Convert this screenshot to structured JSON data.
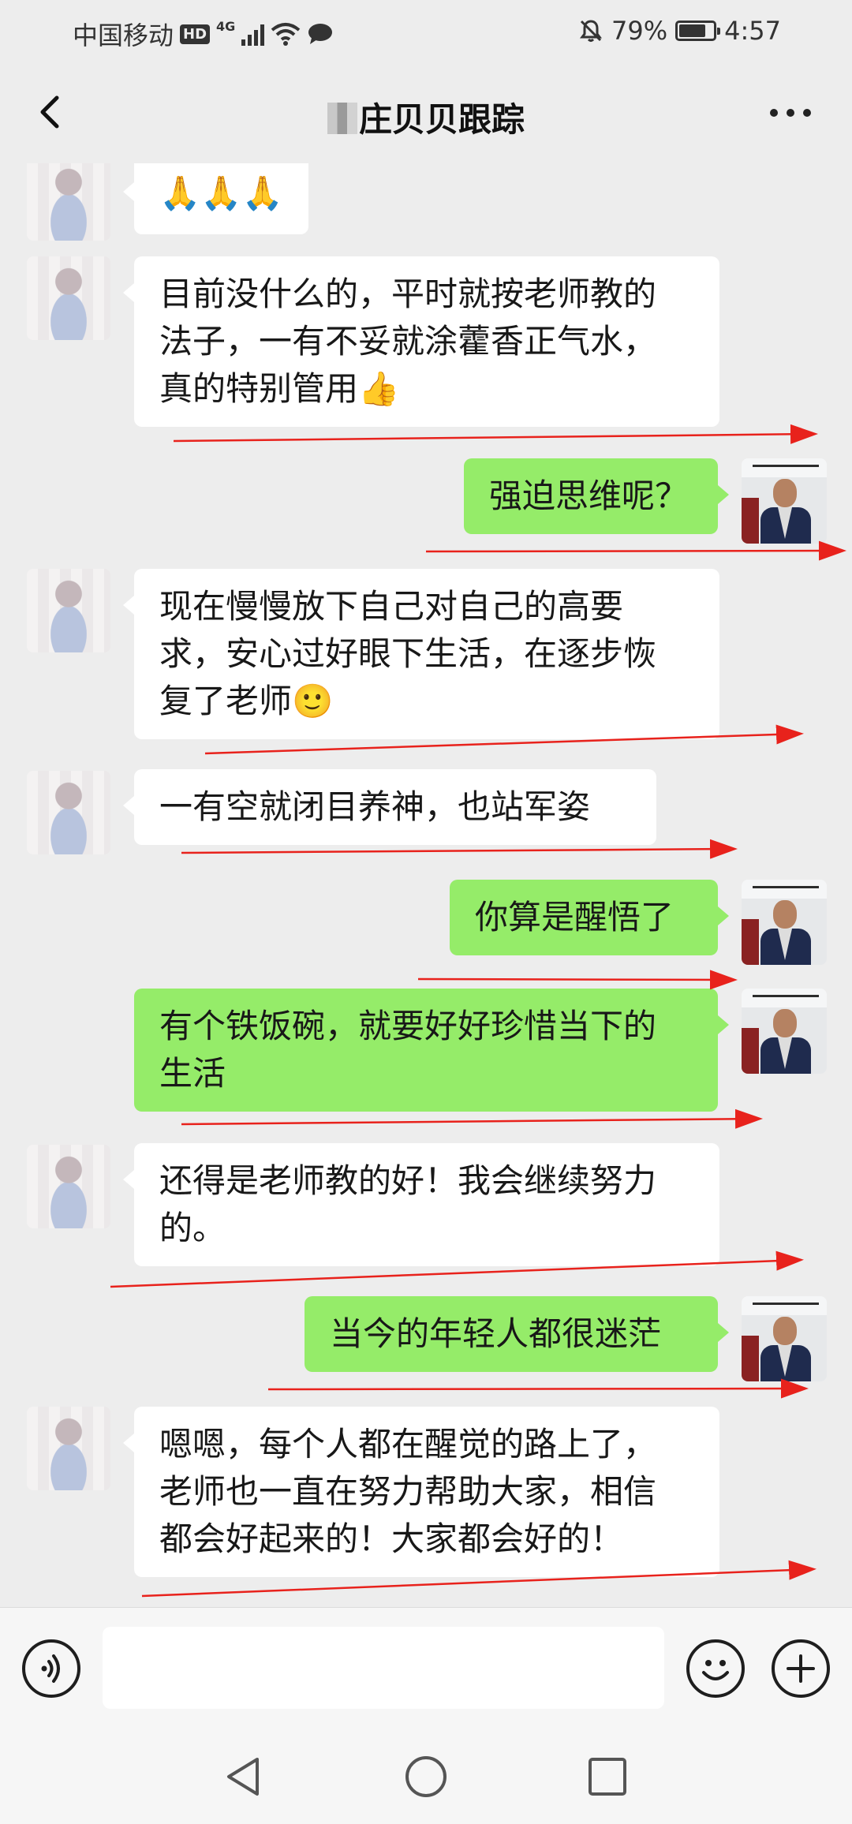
{
  "status_bar": {
    "carrier": "中国移动",
    "hd": "HD",
    "network": "4G",
    "battery": "79%",
    "battery_level": 0.79,
    "time": "4:57"
  },
  "header": {
    "title": "庄贝贝跟踪"
  },
  "messages": [
    {
      "side": "in",
      "text": "🙏🙏🙏"
    },
    {
      "side": "in",
      "text": "目前没什么的，平时就按老师教的\n法子，一有不妥就涂藿香正气水，\n真的特别管用👍"
    },
    {
      "side": "out",
      "text": "强迫思维呢？"
    },
    {
      "side": "in",
      "text": "现在慢慢放下自己对自己的高要\n求，安心过好眼下生活，在逐步恢\n复了老师🙂"
    },
    {
      "side": "in",
      "text": "一有空就闭目养神，也站军姿"
    },
    {
      "side": "out",
      "text": "你算是醒悟了"
    },
    {
      "side": "out",
      "text": "有个铁饭碗，就要好好珍惜当下的\n生活"
    },
    {
      "side": "in",
      "text": "还得是老师教的好！我会继续努力\n的。"
    },
    {
      "side": "out",
      "text": "当今的年轻人都很迷茫"
    },
    {
      "side": "in",
      "text": "嗯嗯，每个人都在醒觉的路上了，\n老师也一直在努力帮助大家，相信\n都会好起来的！大家都会好的！"
    }
  ],
  "input": {
    "value": "",
    "placeholder": ""
  },
  "colors": {
    "background": "#ededed",
    "incoming_bubble": "#ffffff",
    "outgoing_bubble": "#95ec69",
    "annotation_arrow": "#e8221c"
  },
  "icons": {
    "back": "chevron-left-icon",
    "more": "more-dots-icon",
    "voice": "voice-icon",
    "emoji": "emoji-icon",
    "add": "plus-icon",
    "nav_back": "nav-back-icon",
    "nav_home": "nav-home-icon",
    "nav_recent": "nav-recent-icon"
  }
}
